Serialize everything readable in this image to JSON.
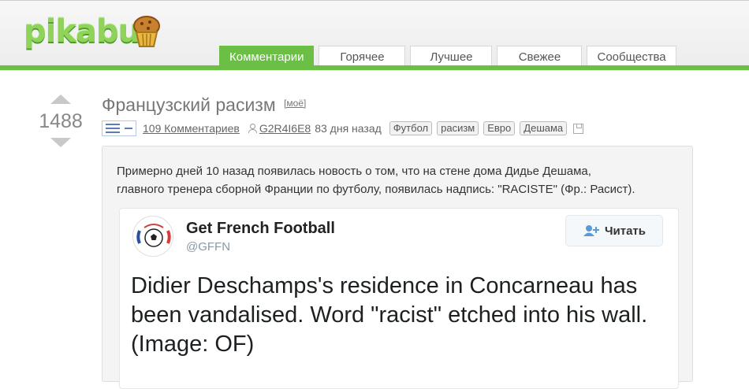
{
  "brand": {
    "logo_text": "pikabu",
    "accent": "#6bbf45"
  },
  "nav": {
    "tabs": [
      {
        "label": "Комментарии",
        "active": true
      },
      {
        "label": "Горячее",
        "active": false
      },
      {
        "label": "Лучшее",
        "active": false
      },
      {
        "label": "Свежее",
        "active": false
      },
      {
        "label": "Сообщества",
        "active": false
      }
    ]
  },
  "story": {
    "rating": "1488",
    "title": "Французский расизм",
    "my_link": "[моё]",
    "comments": "109 Комментариев",
    "author": "G2R4I6E8",
    "age": "83 дня назад",
    "tags": [
      "Футбол",
      "расизм",
      "Евро",
      "Дешама"
    ],
    "text_line1": "Примерно дней 10 назад появилась новость о том, что на стене дома Дидье Дешама,",
    "text_line2": "главного тренера сборной Франции по футболу, появилась надпись: \"RACISTE\" (Фр.: Расист)."
  },
  "tweet": {
    "name": "Get French Football",
    "handle": "@GFFN",
    "follow_label": "Читать",
    "text": "Didier Deschamps's residence in Concarneau has been vandalised. Word \"racist\" etched into his wall. (Image: OF)"
  }
}
